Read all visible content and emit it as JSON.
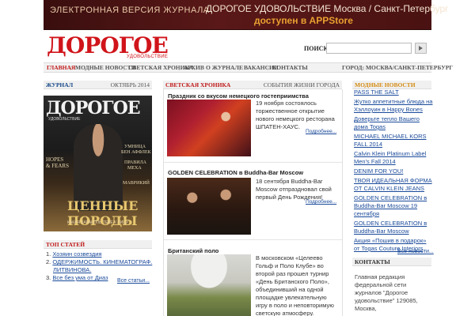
{
  "banner": {
    "left": "ЭЛЕКТРОННАЯ ВЕРСИЯ ЖУРНАЛА",
    "right": "ДОРОГОЕ УДОВОЛЬСТВИЕ Москва / Санкт-Петербург",
    "sub": "доступен в APPStore"
  },
  "header": {
    "logo": "ДОРОГОЕ",
    "logo_sub": "УДОВОЛЬСТВИЕ",
    "search_label": "ПОИСК:",
    "search_value": ""
  },
  "nav": {
    "items": [
      "ГЛАВНАЯ",
      "МОДНЫЕ НОВОСТИ",
      "СВЕТСКАЯ ХРОНИКА",
      "АРХИВ",
      "О ЖУРНАЛЕ",
      "ВАКАНСИИ",
      "КОНТАКТЫ"
    ],
    "city_label": "ГОРОД:",
    "city_value": "МОСКВА/САНКТ-ПЕТЕРБУРГ"
  },
  "journal": {
    "title": "ЖУРНАЛ",
    "issue": "ОКТЯБРЬ 2014",
    "cover": {
      "title": "ДОРОГОЕ",
      "subtitle": "УДОВОЛЬСТВИЕ",
      "left1": "HOPES",
      "left2": "& FEARS",
      "right1": "УМНИЦА",
      "right2": "БЕН АФФЛЕК",
      "right3": "ПРАВИЛА",
      "right4": "МЕХА",
      "right5": "МАВРИКИЙ",
      "big": "ЦЕННЫЕ ПОРОДЫ",
      "small": "КАКАЯ КАРАКОЛЬ ТЕБЕ К ЛИЦУ"
    }
  },
  "top_articles": {
    "title": "ТОП СТАТЕЙ",
    "items": [
      {
        "num": "1.",
        "label": "Хозяин созвездия"
      },
      {
        "num": "2.",
        "label": "ОДЕРЖИМОСТЬ. КИНЕМАТОГРАФ."
      },
      {
        "num": "",
        "label": "ЛИТВИНОВА."
      },
      {
        "num": "3.",
        "label": "Все без ума от Диаз"
      }
    ],
    "all": "Все статьи..."
  },
  "chronicle": {
    "title": "СВЕТСКАЯ ХРОНИКА",
    "subtitle": "СОБЫТИЯ ЖИЗНИ ГОРОДА",
    "more": "Подробнее...",
    "articles": [
      {
        "title": "Праздник со вкусом немецкого гостеприимства",
        "text": "19 ноября состоялось торжественное открытие нового немецкого ресторана ШПАТЕН-ХАУС."
      },
      {
        "title": "GOLDEN CELEBRATION в Buddha-Bar Moscow",
        "text": "18 сентября Buddha-Bar Moscow отпраздновал свой первый День Рождения!"
      },
      {
        "title": "Британский поло",
        "text": "В московском «Целеево Гольф и Поло Клубе» во второй раз прошел турнир «День Британского Поло», объединивший на одной площадке увлекательную игру в поло и неповторимую светскую атмосферу."
      }
    ]
  },
  "fashion_news": {
    "title": "МОДНЫЕ НОВОСТИ",
    "items": [
      "PASS THE SALT",
      "Жутко аппетитные блюда на Хэллоуин в Happy Bones",
      "Доверьте тепло Вашего дома Togas",
      "MICHAEL MICHAEL KORS FALL 2014",
      "Calvin Klein Platinum Label Men's Fall 2014",
      "DENIM FOR YOU!",
      "ТВОЯ ИДЕАЛЬНАЯ ФОРМА ОТ CALVIN KLEIN JEANS",
      "GOLDEN CELEBRATION в Buddha-Bar Moscow 19 сентября",
      "GOLDEN CELEBRATION в Buddha-Bar Moscow",
      "Акция «Пошив в подарок» от Togas Couture Interiors"
    ],
    "all": "Все новости..."
  },
  "contacts": {
    "title": "КОНТАКТЫ",
    "text": "Главная редакция федеральной сети журналов \"Дорогое удовольствие\" 129085, Москва,"
  },
  "colors": {
    "brand_red": "#d0141a",
    "link_blue": "#1a4a9a",
    "banner_bg": "#4a1212",
    "banner_accent": "#e8a030"
  }
}
